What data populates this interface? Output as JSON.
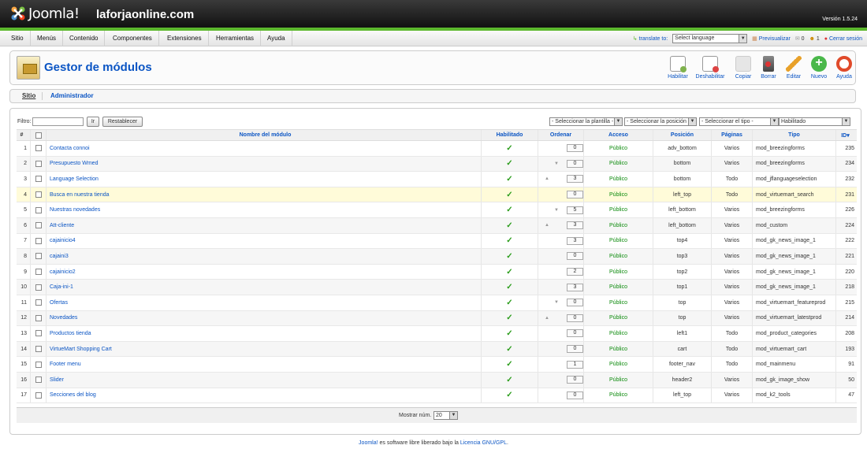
{
  "header": {
    "brand": "Joomla!",
    "site_name": "laforjaonline.com",
    "version": "Versión 1.5.24"
  },
  "menu": [
    "Sitio",
    "Menús",
    "Contenido",
    "Componentes",
    "Extensiones",
    "Herramientas",
    "Ayuda"
  ],
  "status": {
    "translate_label": "translate to:",
    "language_select": "Select language",
    "preview": "Previsualizar",
    "messages_count": "0",
    "users_count": "1",
    "logout": "Cerrar sesión"
  },
  "toolbar": {
    "title": "Gestor de módulos",
    "buttons": [
      {
        "label": "Habilitar",
        "icon": "enable-icon",
        "color": "#7fb24c"
      },
      {
        "label": "Deshabilitar",
        "icon": "disable-icon",
        "color": "#d44"
      },
      {
        "label": "Copiar",
        "icon": "copy-icon",
        "color": "#bbb"
      },
      {
        "label": "Borrar",
        "icon": "trash-icon",
        "color": "#c33"
      },
      {
        "label": "Editar",
        "icon": "pencil-icon",
        "color": "#e8a12a"
      },
      {
        "label": "Nuevo",
        "icon": "plus-icon",
        "color": "#4ab84a"
      },
      {
        "label": "Ayuda",
        "icon": "help-icon",
        "color": "#e04a2a"
      }
    ]
  },
  "tabs": [
    "Sitio",
    "Administrador"
  ],
  "filter": {
    "label": "Filtro:",
    "value": "",
    "go": "Ir",
    "reset": "Restablecer",
    "template": "- Seleccionar la plantilla -",
    "position": "- Seleccionar la posición -",
    "type": "- Seleccionar el tipo -",
    "state": "Habilitado"
  },
  "table": {
    "headers": {
      "num": "#",
      "name": "Nombre del módulo",
      "enabled": "Habilitado",
      "order": "Ordenar",
      "access": "Acceso",
      "position": "Posición",
      "pages": "Páginas",
      "type": "Tipo",
      "id": "ID▾"
    },
    "rows": [
      {
        "n": "1",
        "name": "Contacta connoi",
        "order": "0",
        "up": "",
        "down": "",
        "access": "Público",
        "position": "adv_bottom",
        "pages": "Varios",
        "type": "mod_breezingforms",
        "id": "235"
      },
      {
        "n": "2",
        "name": "Presupuesto Wmed",
        "order": "0",
        "up": "",
        "down": "▼",
        "access": "Público",
        "position": "bottom",
        "pages": "Varios",
        "type": "mod_breezingforms",
        "id": "234"
      },
      {
        "n": "3",
        "name": "Language Selection",
        "order": "3",
        "up": "▲",
        "down": "",
        "access": "Público",
        "position": "bottom",
        "pages": "Todo",
        "type": "mod_jflanguageselection",
        "id": "232"
      },
      {
        "n": "4",
        "name": "Busca en nuestra tienda",
        "order": "0",
        "up": "",
        "down": "",
        "access": "Público",
        "position": "left_top",
        "pages": "Todo",
        "type": "mod_virtuemart_search",
        "id": "231"
      },
      {
        "n": "5",
        "name": "Nuestras novedades",
        "order": "5",
        "up": "",
        "down": "▼",
        "access": "Público",
        "position": "left_bottom",
        "pages": "Varios",
        "type": "mod_breezingforms",
        "id": "226"
      },
      {
        "n": "6",
        "name": "Att-cliente",
        "order": "3",
        "up": "▲",
        "down": "",
        "access": "Público",
        "position": "left_bottom",
        "pages": "Varios",
        "type": "mod_custom",
        "id": "224"
      },
      {
        "n": "7",
        "name": "cajainicio4",
        "order": "3",
        "up": "",
        "down": "",
        "access": "Público",
        "position": "top4",
        "pages": "Varios",
        "type": "mod_gk_news_image_1",
        "id": "222"
      },
      {
        "n": "8",
        "name": "cajaini3",
        "order": "0",
        "up": "",
        "down": "",
        "access": "Público",
        "position": "top3",
        "pages": "Varios",
        "type": "mod_gk_news_image_1",
        "id": "221"
      },
      {
        "n": "9",
        "name": "cajainicio2",
        "order": "2",
        "up": "",
        "down": "",
        "access": "Público",
        "position": "top2",
        "pages": "Varios",
        "type": "mod_gk_news_image_1",
        "id": "220"
      },
      {
        "n": "10",
        "name": "Caja-ini-1",
        "order": "3",
        "up": "",
        "down": "",
        "access": "Público",
        "position": "top1",
        "pages": "Varios",
        "type": "mod_gk_news_image_1",
        "id": "218"
      },
      {
        "n": "11",
        "name": "Ofertas",
        "order": "0",
        "up": "",
        "down": "▼",
        "access": "Público",
        "position": "top",
        "pages": "Varios",
        "type": "mod_virtuemart_featureprod",
        "id": "215"
      },
      {
        "n": "12",
        "name": "Novedades",
        "order": "0",
        "up": "▲",
        "down": "",
        "access": "Público",
        "position": "top",
        "pages": "Varios",
        "type": "mod_virtuemart_latestprod",
        "id": "214"
      },
      {
        "n": "13",
        "name": "Productos tienda",
        "order": "0",
        "up": "",
        "down": "",
        "access": "Público",
        "position": "left1",
        "pages": "Todo",
        "type": "mod_product_categories",
        "id": "208"
      },
      {
        "n": "14",
        "name": "VirtueMart Shopping Cart",
        "order": "0",
        "up": "",
        "down": "",
        "access": "Público",
        "position": "cart",
        "pages": "Todo",
        "type": "mod_virtuemart_cart",
        "id": "193"
      },
      {
        "n": "15",
        "name": "Footer menu",
        "order": "1",
        "up": "",
        "down": "",
        "access": "Público",
        "position": "footer_nav",
        "pages": "Todo",
        "type": "mod_mainmenu",
        "id": "91"
      },
      {
        "n": "16",
        "name": "Slider",
        "order": "0",
        "up": "",
        "down": "",
        "access": "Público",
        "position": "header2",
        "pages": "Varios",
        "type": "mod_gk_image_show",
        "id": "50"
      },
      {
        "n": "17",
        "name": "Secciones del blog",
        "order": "0",
        "up": "",
        "down": "",
        "access": "Público",
        "position": "left_top",
        "pages": "Varios",
        "type": "mod_k2_tools",
        "id": "47"
      }
    ]
  },
  "pagination": {
    "label": "Mostrar núm.",
    "value": "20"
  },
  "legal": {
    "prefix": "Joomla!",
    "middle": " es software libre liberado bajo la ",
    "license": "Licencia GNU/GPL",
    "suffix": "."
  }
}
